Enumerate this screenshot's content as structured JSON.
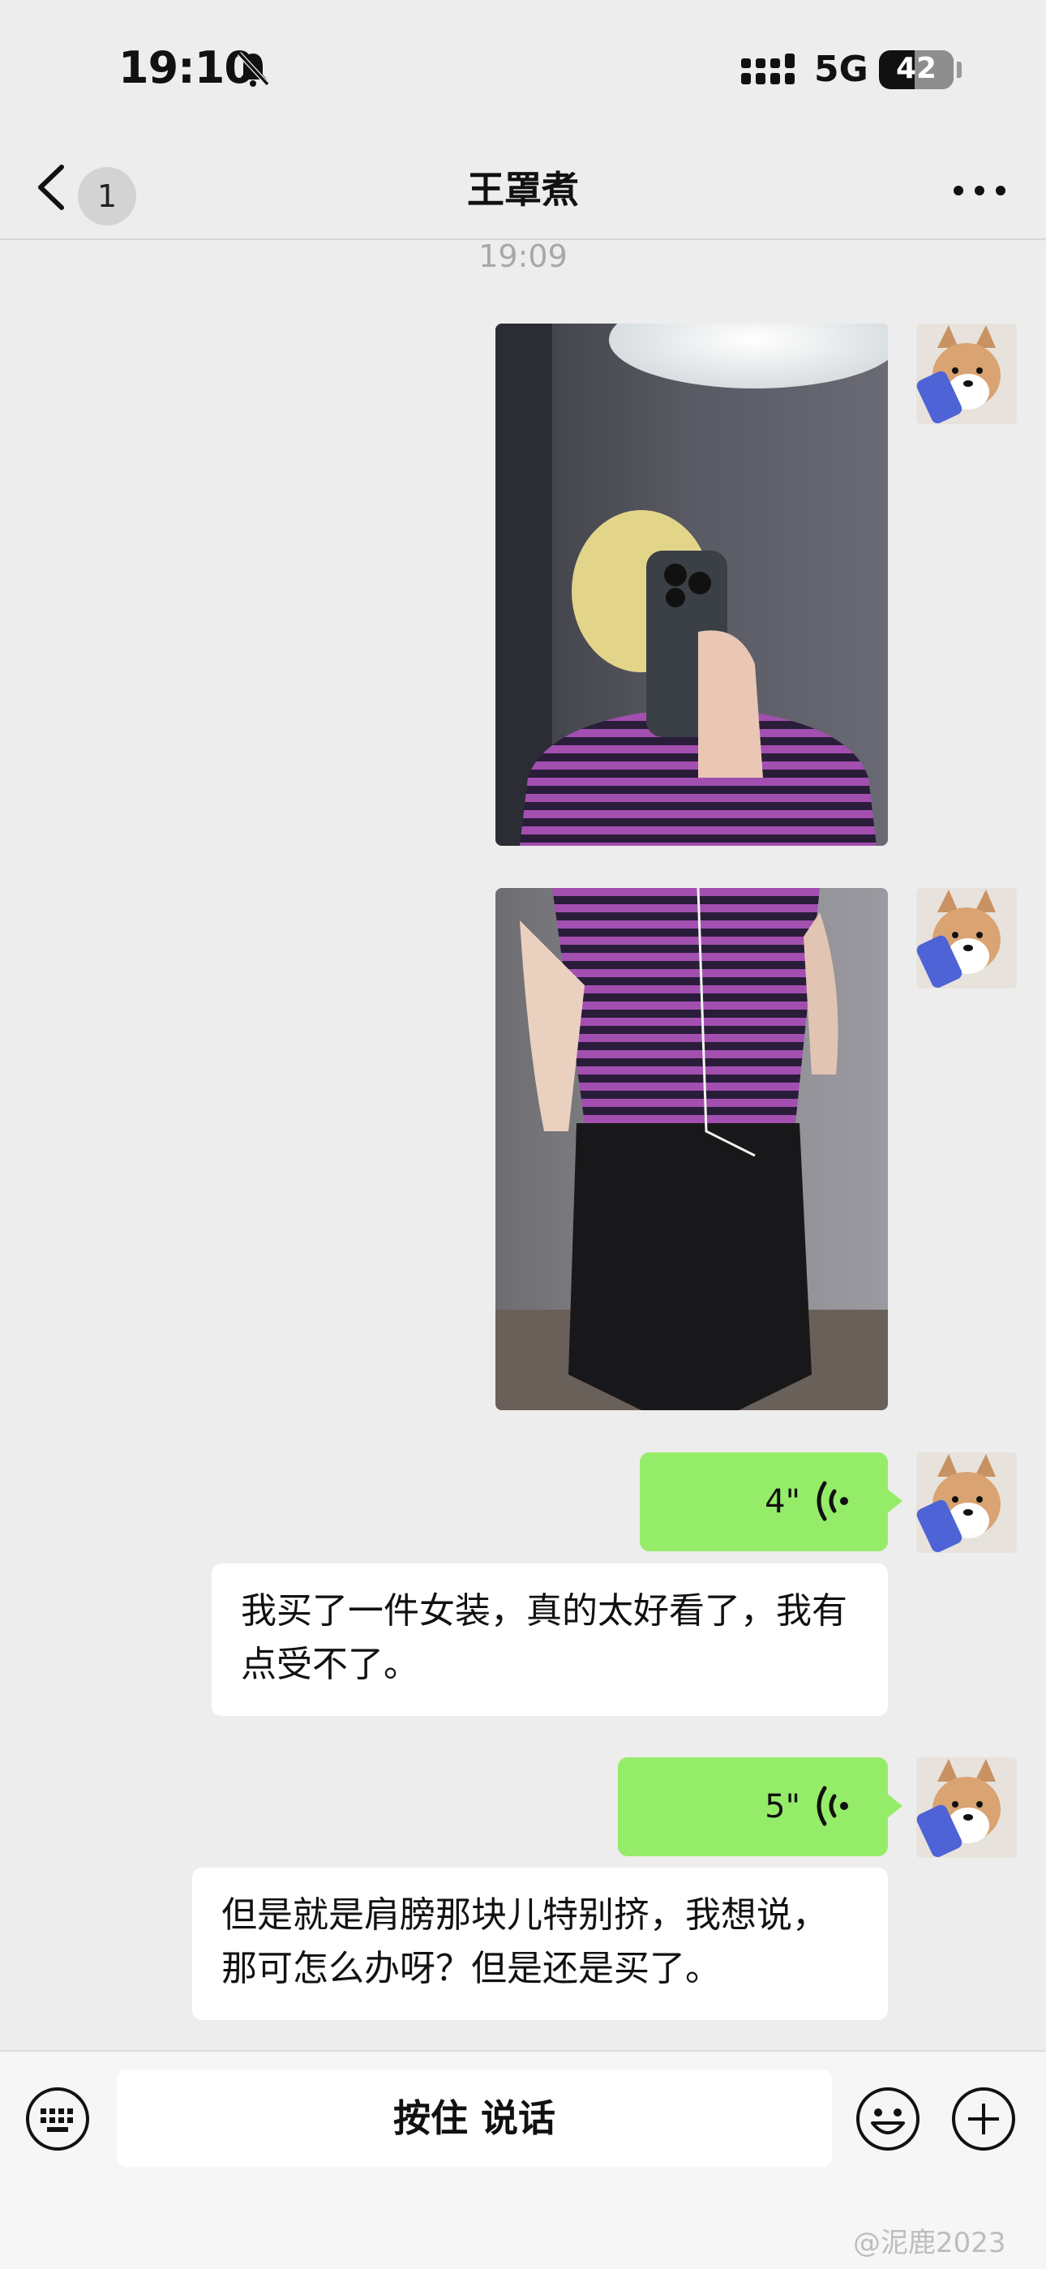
{
  "status_bar": {
    "time": "19:10",
    "network": "5G",
    "battery": "42"
  },
  "nav": {
    "unread": "1",
    "title": "王罩煮"
  },
  "timestamp": "19:09",
  "messages": {
    "voice1": {
      "duration": "4\""
    },
    "text1": "我买了一件女装，真的太好看了，我有点受不了。",
    "voice2": {
      "duration": "5\""
    },
    "text2": "但是就是肩膀那块儿特别挤，我想说，那可怎么办呀？但是还是买了。"
  },
  "input_bar": {
    "hold_to_talk": "按住 说话"
  },
  "watermark": "@泥鹿2023",
  "colors": {
    "bubble_self": "#95ec69",
    "background": "#ededed",
    "bubble_other": "#ffffff"
  }
}
